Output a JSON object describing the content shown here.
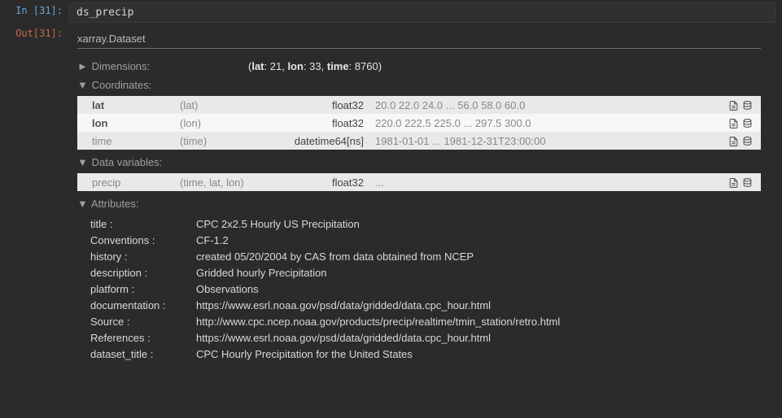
{
  "prompts": {
    "in_label": "In [31]:",
    "out_label": "Out[31]:"
  },
  "input_code": "ds_precip",
  "repr_header": "xarray.Dataset",
  "sections": {
    "dimensions": {
      "tri": "►",
      "label": "Dimensions:",
      "content_prefix": "(",
      "content_suffix": ")",
      "parts": [
        {
          "name": "lat",
          "val": "21"
        },
        {
          "name": "lon",
          "val": "33"
        },
        {
          "name": "time",
          "val": "8760"
        }
      ]
    },
    "coordinates": {
      "tri": "▼",
      "label": "Coordinates:"
    },
    "datavars": {
      "tri": "▼",
      "label": "Data variables:"
    },
    "attributes": {
      "tri": "▼",
      "label": "Attributes:"
    }
  },
  "coords": [
    {
      "name": "lat",
      "dims": "(lat)",
      "dtype": "float32",
      "vals": "20.0 22.0 24.0 ... 56.0 58.0 60.0",
      "bold": true
    },
    {
      "name": "lon",
      "dims": "(lon)",
      "dtype": "float32",
      "vals": "220.0 222.5 225.0 ... 297.5 300.0",
      "bold": true
    },
    {
      "name": "time",
      "dims": "(time)",
      "dtype": "datetime64[ns]",
      "vals": "1981-01-01 ... 1981-12-31T23:00:00",
      "bold": false
    }
  ],
  "datavars_rows": [
    {
      "name": "precip",
      "dims": "(time, lat, lon)",
      "dtype": "float32",
      "vals": "..."
    }
  ],
  "attrs": [
    {
      "k": "title :",
      "v": "CPC 2x2.5 Hourly US Precipitation"
    },
    {
      "k": "Conventions :",
      "v": "CF-1.2"
    },
    {
      "k": "history :",
      "v": "created 05/20/2004 by CAS from data obtained from NCEP"
    },
    {
      "k": "description :",
      "v": "Gridded hourly Precipitation"
    },
    {
      "k": "platform :",
      "v": "Observations"
    },
    {
      "k": "documentation :",
      "v": "https://www.esrl.noaa.gov/psd/data/gridded/data.cpc_hour.html"
    },
    {
      "k": "Source :",
      "v": "http://www.cpc.ncep.noaa.gov/products/precip/realtime/tmin_station/retro.html"
    },
    {
      "k": "References :",
      "v": "https://www.esrl.noaa.gov/psd/data/gridded/data.cpc_hour.html"
    },
    {
      "k": "dataset_title :",
      "v": "CPC Hourly Precipitation for the United States"
    }
  ]
}
